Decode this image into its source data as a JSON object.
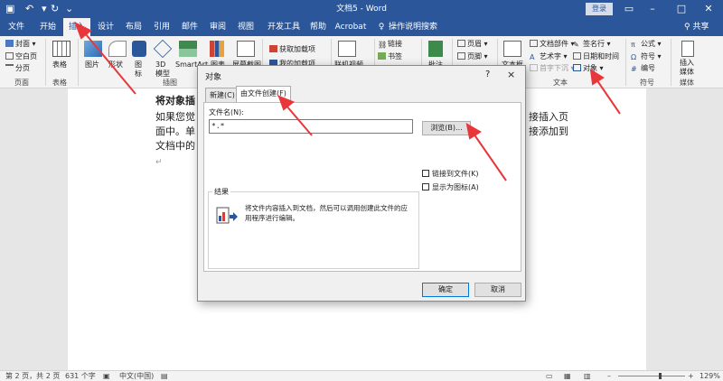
{
  "titlebar": {
    "title": "文档5 - Word",
    "login_label": "登录",
    "restore_icon": "ribbon-display-icon",
    "minimize_icon": "minimize-icon",
    "maximize_icon": "maximize-icon",
    "close_icon": "close-icon"
  },
  "tabs": [
    {
      "label": "文件"
    },
    {
      "label": "开始"
    },
    {
      "label": "插入",
      "active": true
    },
    {
      "label": "设计"
    },
    {
      "label": "布局"
    },
    {
      "label": "引用"
    },
    {
      "label": "邮件"
    },
    {
      "label": "审阅"
    },
    {
      "label": "视图"
    },
    {
      "label": "开发工具"
    },
    {
      "label": "帮助"
    },
    {
      "label": "Acrobat"
    },
    {
      "label": "操作说明搜索"
    }
  ],
  "share_label": "共享",
  "ribbon": {
    "pages": {
      "cover": "封面",
      "blank": "空白页",
      "break": "分页",
      "group": "页面"
    },
    "tables": {
      "table": "表格",
      "group": "表格"
    },
    "illustrations": {
      "picture": "图片",
      "shape": "形状",
      "icon": "图标",
      "model": "3D 模型",
      "smartart": "SmartArt",
      "chart": "图表",
      "screenshot": "屏幕截图",
      "group": "插图"
    },
    "addins": {
      "get": "获取加载项",
      "my": "我的加载项"
    },
    "media": {
      "online_video": "联机视频"
    },
    "links": {
      "link": "链接",
      "bookmark": "书签"
    },
    "comments": {
      "comment": "批注"
    },
    "header_footer": {
      "header": "页眉",
      "footer": "页脚"
    },
    "text": {
      "textbox": "文本框",
      "docparts": "文档部件",
      "wordart": "艺术字",
      "dropcap": "首字下沉",
      "signature": "签名行",
      "datetime": "日期和时间",
      "object": "对象",
      "group": "文本"
    },
    "symbols": {
      "equation": "公式",
      "symbol": "符号",
      "number": "编号",
      "group": "符号"
    },
    "embed": {
      "label": "插入媒体",
      "group": "媒体"
    }
  },
  "document": {
    "heading": "将对象插",
    "line1a": "如果您觉",
    "line1b": "接插入页",
    "line2a": "面中。单",
    "line2b": "接添加到",
    "line3": "文档中的"
  },
  "dialog": {
    "title": "对象",
    "help": "?",
    "close": "×",
    "tab_new": "新建(C)",
    "tab_from_file": "由文件创建(F)",
    "filename_label": "文件名(N):",
    "filename_value": "*.*",
    "browse": "浏览(B)...",
    "link_to_file": "链接到文件(K)",
    "show_as_icon": "显示为图标(A)",
    "result_label": "结果",
    "result_desc": "将文件内容插入到文档，然后可以调用创建此文件的应用程序进行编辑。",
    "ok": "确定",
    "cancel": "取消"
  },
  "statusbar": {
    "page": "第 2 页，共 2 页",
    "words": "631 个字",
    "language": "中文(中国)",
    "zoom": "129%"
  },
  "colors": {
    "accent": "#2b579a",
    "annotation": "#e8373a"
  }
}
